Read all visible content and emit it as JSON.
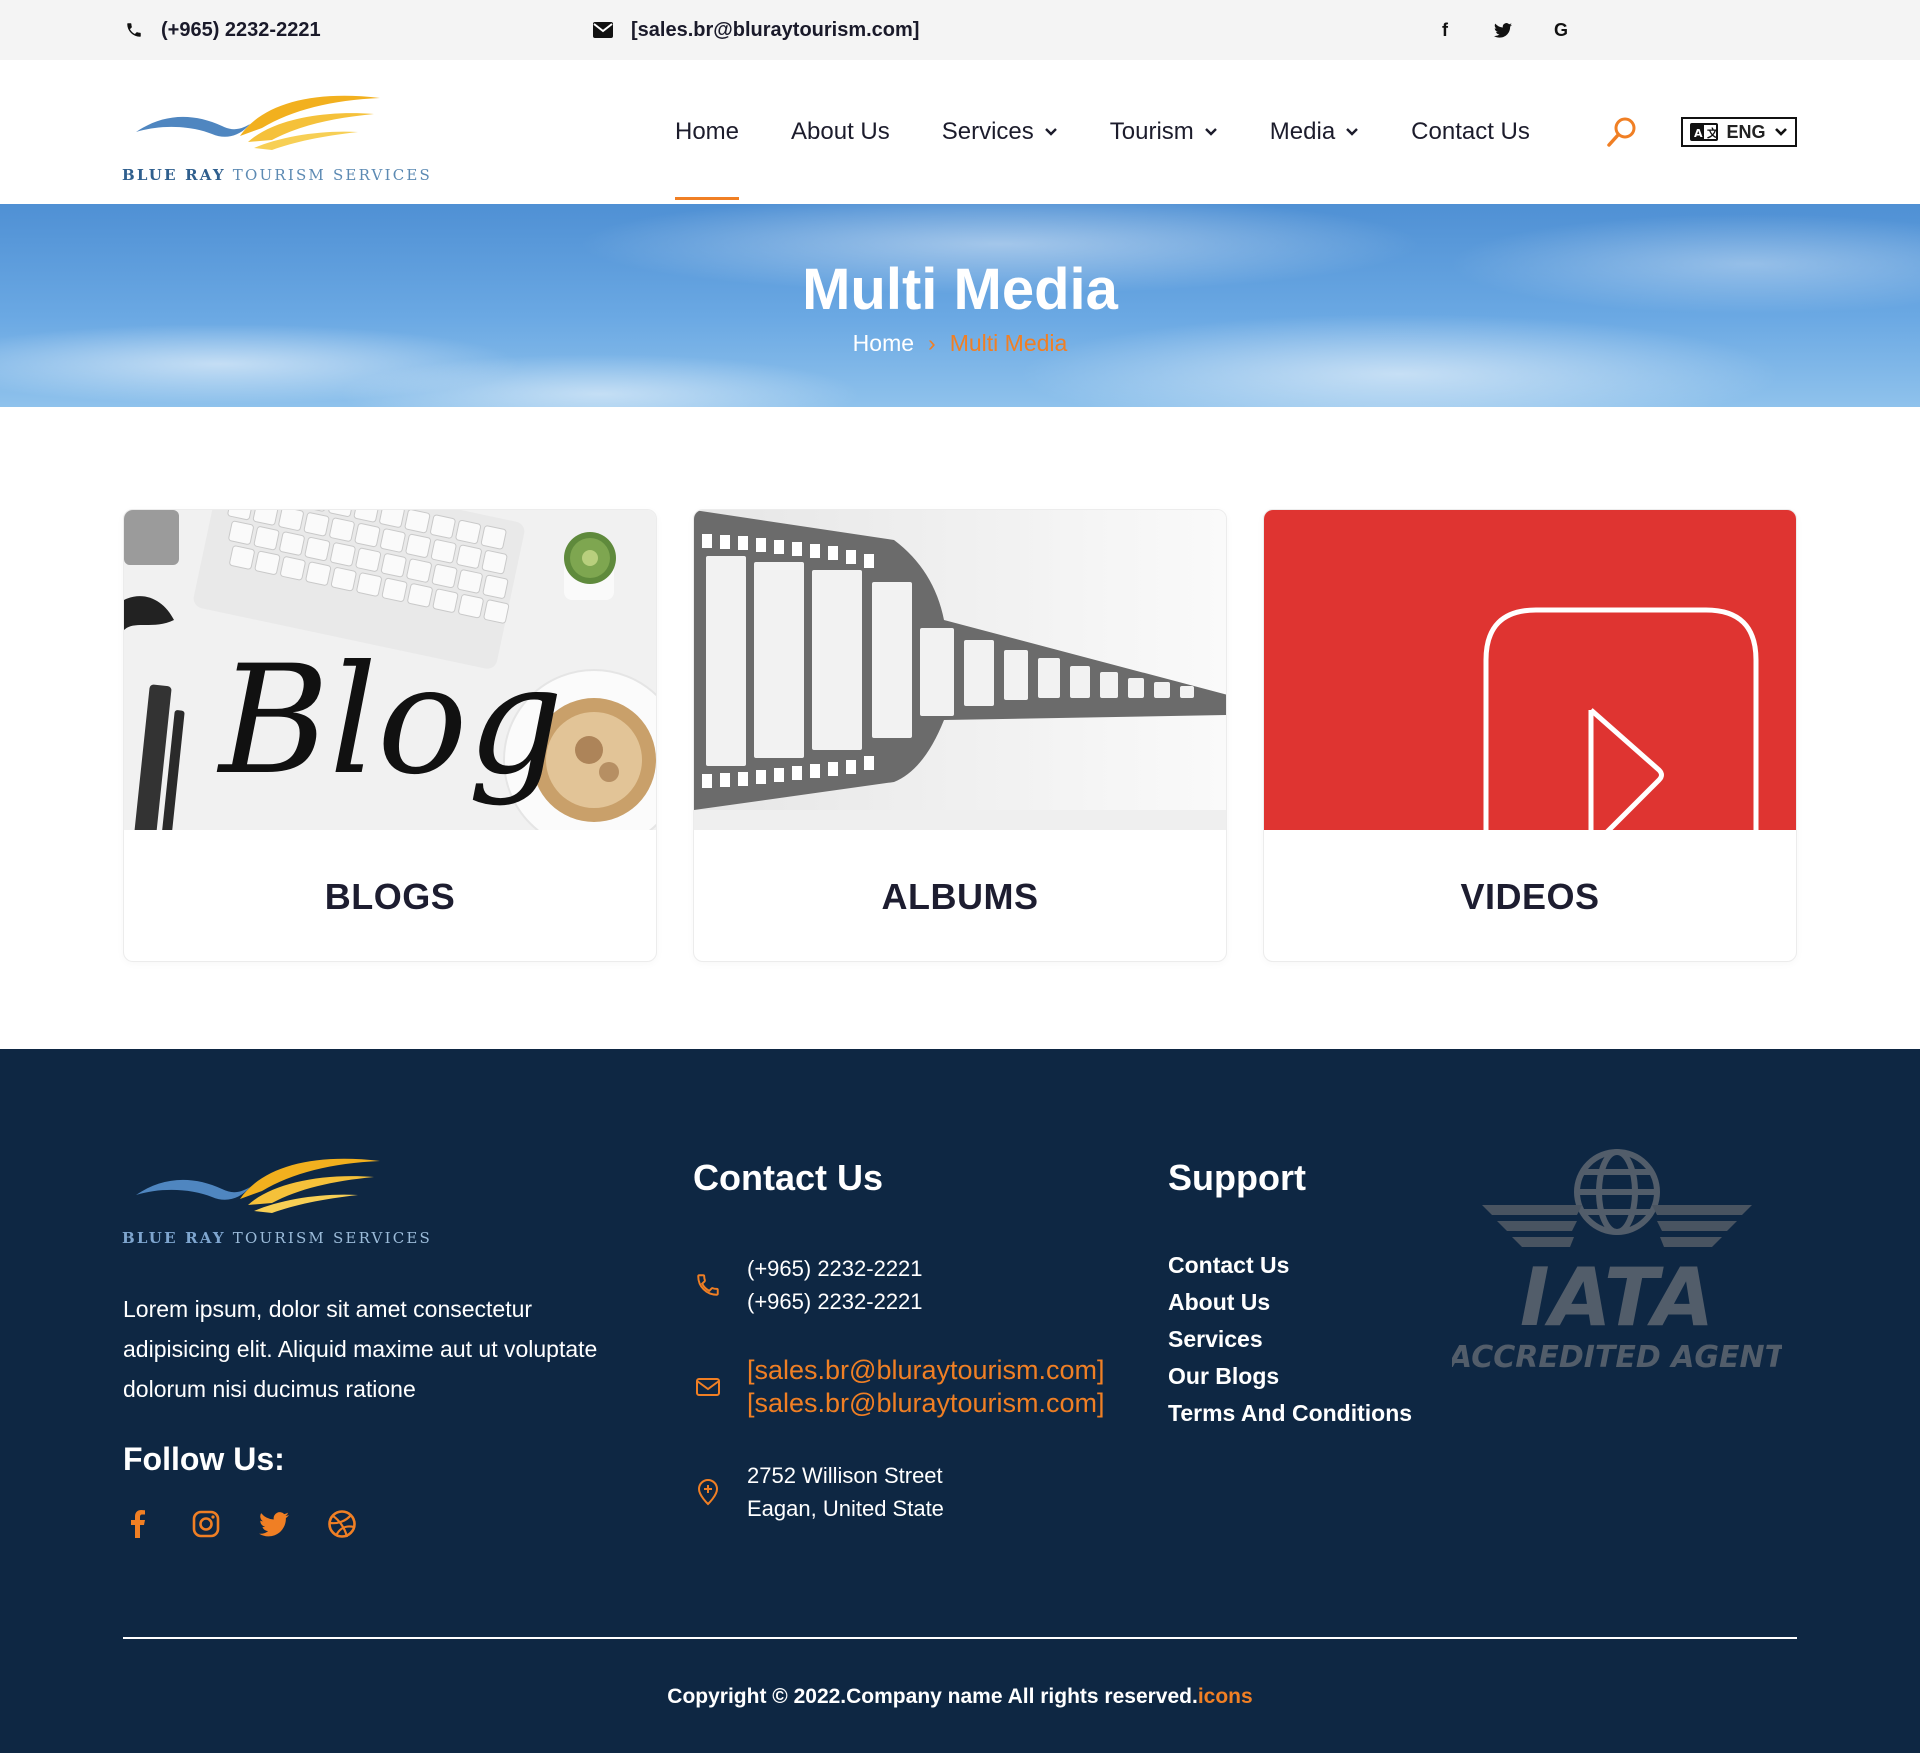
{
  "topbar": {
    "phone": "(+965) 2232-2221",
    "email": "[sales.br@bluraytourism.com]",
    "social": [
      "facebook-icon",
      "twitter-icon",
      "google-icon"
    ]
  },
  "brand": {
    "name_part1": "BLUE RAY",
    "name_part2": "TOURISM SERVICES",
    "colors": {
      "wing_gold": "#f2b01e",
      "wing_blue": "#4f86c0",
      "accent": "#f07f24"
    }
  },
  "nav": {
    "items": [
      {
        "label": "Home",
        "active": true,
        "dropdown": false
      },
      {
        "label": "About Us",
        "active": false,
        "dropdown": false
      },
      {
        "label": "Services",
        "active": false,
        "dropdown": true
      },
      {
        "label": "Tourism",
        "active": false,
        "dropdown": true
      },
      {
        "label": "Media",
        "active": false,
        "dropdown": true
      },
      {
        "label": "Contact Us",
        "active": false,
        "dropdown": false
      }
    ],
    "language": "ENG"
  },
  "hero": {
    "title": "Multi Media",
    "breadcrumb": {
      "home": "Home",
      "separator": "›",
      "current": "Multi Media"
    }
  },
  "cards": [
    {
      "title": "BLOGS",
      "image_text": "Blog"
    },
    {
      "title": "ALBUMS"
    },
    {
      "title": "VIDEOS"
    }
  ],
  "footer": {
    "brand_name_part1": "BLUE RAY",
    "brand_name_part2": "TOURISM SERVICES",
    "about": "Lorem ipsum, dolor sit amet consectetur adipisicing elit. Aliquid maxime aut ut voluptate dolorum nisi ducimus ratione",
    "follow_title": "Follow Us:",
    "contact_title": "Contact Us",
    "phones": [
      "(+965) 2232-2221",
      "(+965) 2232-2221"
    ],
    "emails": [
      "[sales.br@bluraytourism.com]",
      "[sales.br@bluraytourism.com]"
    ],
    "address": [
      "2752 Willison Street",
      "Eagan, United State"
    ],
    "support_title": "Support",
    "support_links": [
      "Contact Us",
      "About Us",
      "Services",
      "Our Blogs",
      "Terms And Conditions"
    ],
    "iata": {
      "line1": "IATA",
      "line2": "ACCREDITED AGENT"
    },
    "copyright": "Copyright © 2022.Company name All rights reserved.",
    "copyright_link": "icons"
  }
}
